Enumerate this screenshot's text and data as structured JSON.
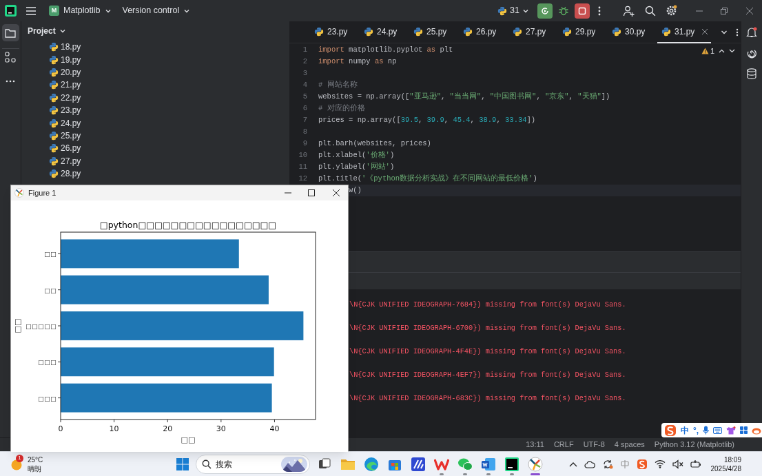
{
  "topbar": {
    "project_badge": "M",
    "project": "Matplotlib",
    "vcs": "Version control",
    "run_config": "31"
  },
  "tool_windows": [
    {
      "kind": "project",
      "selected": true
    },
    {
      "kind": "structure",
      "selected": false
    },
    {
      "kind": "more",
      "selected": false
    }
  ],
  "project_panel": {
    "title": "Project",
    "files": [
      "18.py",
      "19.py",
      "20.py",
      "21.py",
      "22.py",
      "23.py",
      "24.py",
      "25.py",
      "26.py",
      "27.py",
      "28.py"
    ]
  },
  "editor": {
    "tabs": [
      {
        "label": "23.py",
        "selected": false
      },
      {
        "label": "24.py",
        "selected": false
      },
      {
        "label": "25.py",
        "selected": false
      },
      {
        "label": "26.py",
        "selected": false
      },
      {
        "label": "27.py",
        "selected": false
      },
      {
        "label": "29.py",
        "selected": false
      },
      {
        "label": "30.py",
        "selected": false
      },
      {
        "label": "31.py",
        "selected": true
      }
    ],
    "problems": "1",
    "lines": [
      {
        "number": "1",
        "current": false,
        "tokens": [
          {
            "kind": "keyword",
            "text": "import"
          },
          {
            "kind": "plain",
            "text": " matplotlib.pyplot "
          },
          {
            "kind": "keyword",
            "text": "as"
          },
          {
            "kind": "plain",
            "text": " plt"
          }
        ]
      },
      {
        "number": "2",
        "current": false,
        "tokens": [
          {
            "kind": "keyword",
            "text": "import"
          },
          {
            "kind": "plain",
            "text": " numpy "
          },
          {
            "kind": "keyword",
            "text": "as"
          },
          {
            "kind": "plain",
            "text": " np"
          }
        ]
      },
      {
        "number": "3",
        "current": false
      },
      {
        "number": "4",
        "current": false,
        "tokens": [
          {
            "kind": "comment",
            "text": "# 网站名称"
          }
        ]
      },
      {
        "number": "5",
        "current": false,
        "tokens": [
          {
            "kind": "plain",
            "text": "websites = np.array(["
          },
          {
            "kind": "string",
            "text": "\"亚马逊\""
          },
          {
            "kind": "plain",
            "text": ", "
          },
          {
            "kind": "string",
            "text": "\"当当网\""
          },
          {
            "kind": "plain",
            "text": ", "
          },
          {
            "kind": "string",
            "text": "\"中国图书网\""
          },
          {
            "kind": "plain",
            "text": ", "
          },
          {
            "kind": "string",
            "text": "\"京东\""
          },
          {
            "kind": "plain",
            "text": ", "
          },
          {
            "kind": "string",
            "text": "\"天猫\""
          },
          {
            "kind": "plain",
            "text": "])"
          }
        ]
      },
      {
        "number": "6",
        "current": false,
        "tokens": [
          {
            "kind": "comment",
            "text": "# 对应的价格"
          }
        ]
      },
      {
        "number": "7",
        "current": false,
        "tokens": [
          {
            "kind": "plain",
            "text": "prices = np.array(["
          },
          {
            "kind": "number",
            "text": "39.5"
          },
          {
            "kind": "plain",
            "text": ", "
          },
          {
            "kind": "number",
            "text": "39.9"
          },
          {
            "kind": "plain",
            "text": ", "
          },
          {
            "kind": "number",
            "text": "45.4"
          },
          {
            "kind": "plain",
            "text": ", "
          },
          {
            "kind": "number",
            "text": "38.9"
          },
          {
            "kind": "plain",
            "text": ", "
          },
          {
            "kind": "number",
            "text": "33.34"
          },
          {
            "kind": "plain",
            "text": "])"
          }
        ]
      },
      {
        "number": "8",
        "current": false
      },
      {
        "number": "9",
        "current": false,
        "tokens": [
          {
            "kind": "plain",
            "text": "plt.barh(websites, prices)"
          }
        ]
      },
      {
        "number": "10",
        "current": false,
        "tokens": [
          {
            "kind": "plain",
            "text": "plt.xlabel("
          },
          {
            "kind": "string",
            "text": "'价格'"
          },
          {
            "kind": "plain",
            "text": ")"
          }
        ]
      },
      {
        "number": "11",
        "current": false,
        "tokens": [
          {
            "kind": "plain",
            "text": "plt.ylabel("
          },
          {
            "kind": "string",
            "text": "'网站'"
          },
          {
            "kind": "plain",
            "text": ")"
          }
        ]
      },
      {
        "number": "12",
        "current": false,
        "tokens": [
          {
            "kind": "plain",
            "text": "plt.title("
          },
          {
            "kind": "string",
            "text": "'《python数据分析实战》在不同网站的最低价格'"
          },
          {
            "kind": "plain",
            "text": ")"
          }
        ]
      },
      {
        "current": true,
        "tokens": [
          {
            "kind": "plain",
            "text": "w()"
          }
        ]
      }
    ]
  },
  "console": {
    "lines": [
      "\\N{CJK UNIFIED IDEOGRAPH-7684}) missing from font(s) DejaVu Sans.",
      "\\N{CJK UNIFIED IDEOGRAPH-6700}) missing from font(s) DejaVu Sans.",
      "\\N{CJK UNIFIED IDEOGRAPH-4F4E}) missing from font(s) DejaVu Sans.",
      "\\N{CJK UNIFIED IDEOGRAPH-4EF7}) missing from font(s) DejaVu Sans.",
      "\\N{CJK UNIFIED IDEOGRAPH-683C}) missing from font(s) DejaVu Sans."
    ]
  },
  "status_bar": {
    "items": [
      "13:11",
      "CRLF",
      "UTF-8",
      "4 spaces",
      "Python 3.12 (Matplotlib)"
    ]
  },
  "ime_bar": {
    "mode": "中",
    "punctuation": "°,"
  },
  "figure_window": {
    "title": "Figure 1",
    "chart_data": {
      "type": "bar",
      "orientation": "horizontal",
      "title": "□python□□□□□□□□□□□□□□□□□",
      "xlabel": "□□",
      "ylabel": "□□",
      "categories": [
        "□□",
        "□□",
        "□□□□□",
        "□□□",
        "□□□"
      ],
      "values": [
        33.34,
        38.9,
        45.4,
        39.9,
        39.5
      ],
      "xlim": [
        0,
        47.67
      ],
      "xticks": [
        0,
        10,
        20,
        30,
        40
      ]
    }
  },
  "taskbar": {
    "weather": {
      "badge": "1",
      "temperature": "25°C",
      "condition": "晴朗"
    },
    "search_placeholder": "搜索",
    "apps": [
      {
        "kind": "taskview",
        "running": false,
        "selected": false
      },
      {
        "kind": "folder",
        "running": false,
        "selected": false
      },
      {
        "kind": "swirl",
        "running": false,
        "selected": false
      },
      {
        "kind": "bag",
        "running": false,
        "selected": false
      },
      {
        "kind": "slash",
        "running": false,
        "selected": false
      },
      {
        "kind": "zigzag",
        "running": true,
        "selected": false
      },
      {
        "kind": "chat",
        "running": true,
        "selected": false
      },
      {
        "kind": "document",
        "running": true,
        "selected": false
      },
      {
        "kind": "darktile",
        "running": true,
        "selected": false
      },
      {
        "kind": "spokes",
        "running": true,
        "selected": true
      }
    ],
    "clock": {
      "time": "18:09",
      "date": "2025/4/28"
    }
  }
}
